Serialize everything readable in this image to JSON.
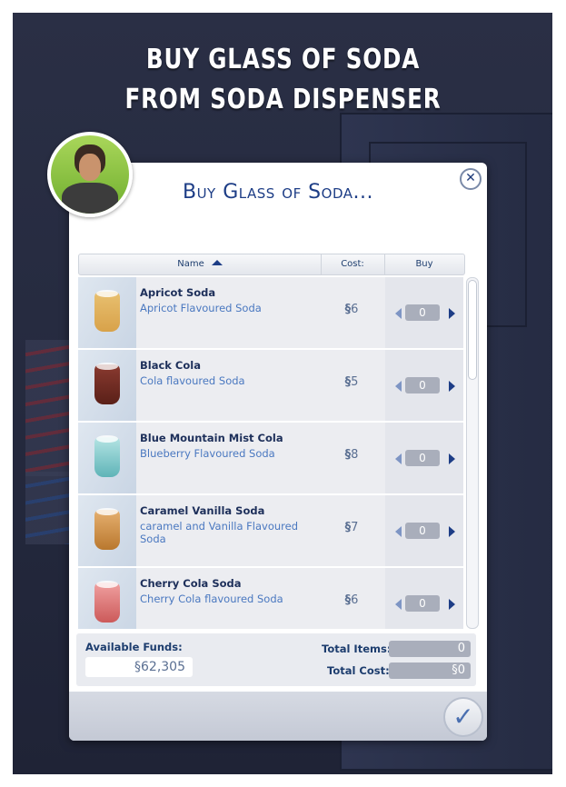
{
  "banner": {
    "line1": "BUY GLASS OF SODA",
    "line2": "FROM SODA DISPENSER"
  },
  "dialog": {
    "title": "Buy Glass of Soda...",
    "close_icon": "close-icon",
    "columns": {
      "name": "Name",
      "cost": "Cost:",
      "buy": "Buy"
    },
    "items": [
      {
        "name": "Apricot Soda",
        "desc": "Apricot Flavoured Soda",
        "currency": "§",
        "cost": "6",
        "qty": "0",
        "color": "#d8a24a"
      },
      {
        "name": "Black Cola",
        "desc": "Cola flavoured Soda",
        "currency": "§",
        "cost": "5",
        "qty": "0",
        "color": "#6b2a22"
      },
      {
        "name": "Blue Mountain Mist Cola",
        "desc": "Blueberry Flavoured Soda",
        "currency": "§",
        "cost": "8",
        "qty": "0",
        "color": "#7fc6c8"
      },
      {
        "name": "Caramel Vanilla Soda",
        "desc": "caramel and Vanilla Flavoured Soda",
        "currency": "§",
        "cost": "7",
        "qty": "0",
        "color": "#c98a45"
      },
      {
        "name": "Cherry Cola Soda",
        "desc": "Cherry Cola flavoured Soda",
        "currency": "§",
        "cost": "6",
        "qty": "0",
        "color": "#d66a6a"
      }
    ],
    "footer": {
      "funds_label": "Available Funds:",
      "funds_value": "§62,305",
      "total_items_label": "Total Items:",
      "total_items_value": "0",
      "total_cost_label": "Total Cost:",
      "total_cost_value": "§0"
    },
    "confirm_icon": "checkmark-icon"
  },
  "colors": {
    "title_blue": "#1d3d86",
    "link_blue": "#4a78c0",
    "row_bg": "#ecedf1"
  }
}
